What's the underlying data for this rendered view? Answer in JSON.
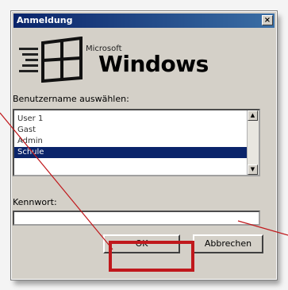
{
  "dialog": {
    "title": "Anmeldung",
    "close_label": "×"
  },
  "logo": {
    "company": "Microsoft",
    "product": "Windows"
  },
  "users": {
    "label": "Benutzername auswählen:",
    "items": [
      "User 1",
      "Gast",
      "Admin",
      "Schule"
    ],
    "selected_index": 3
  },
  "password": {
    "label": "Kennwort:",
    "value": ""
  },
  "buttons": {
    "ok": "OK",
    "cancel": "Abbrechen"
  },
  "colors": {
    "title_bar": "#0a246a",
    "selection": "#0a246a",
    "highlight": "#c0181c",
    "pointer_lines": "#c0181c"
  }
}
